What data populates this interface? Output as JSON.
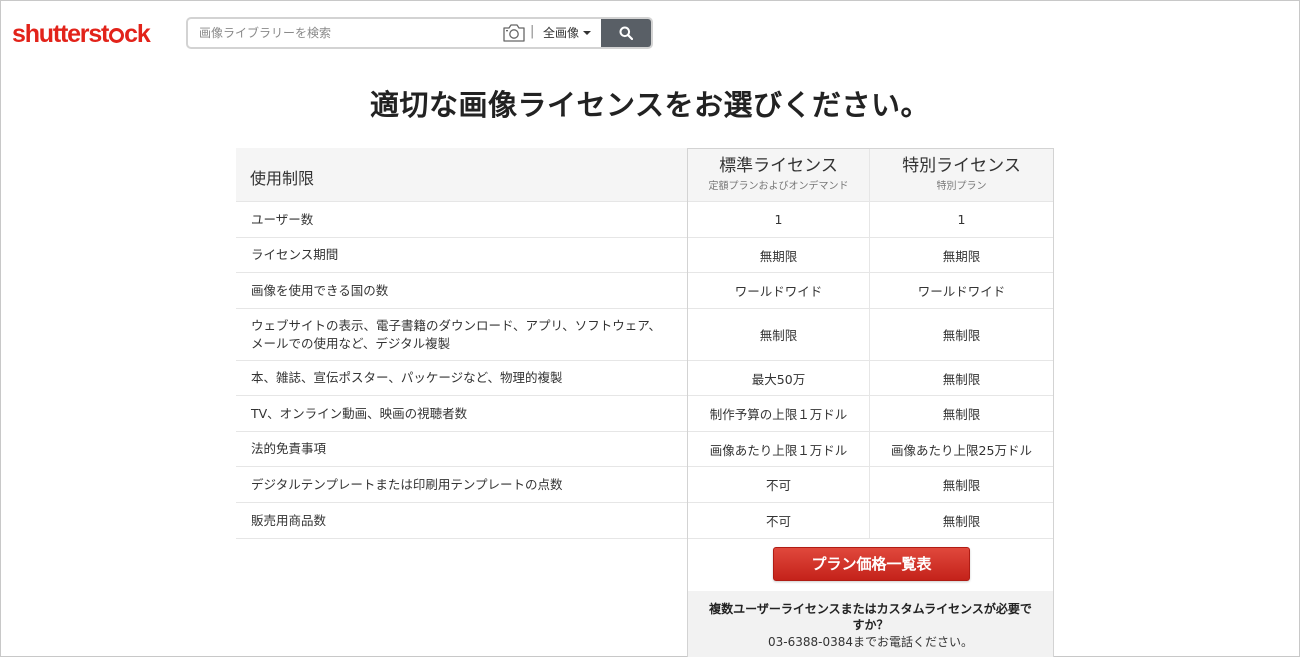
{
  "header": {
    "logo_before": "shutterst",
    "logo_after": "ck",
    "search_placeholder": "画像ライブラリーを検索",
    "separator": "|",
    "type_select_label": "全画像",
    "icons": {
      "camera": "camera-icon",
      "caret": "caret-down-icon",
      "search": "search-icon"
    }
  },
  "main": {
    "title": "適切な画像ライセンスをお選びください。",
    "table": {
      "header_label": "使用制限",
      "plans": [
        {
          "name": "標準ライセンス",
          "sub": "定額プランおよびオンデマンド"
        },
        {
          "name": "特別ライセンス",
          "sub": "特別プラン"
        }
      ],
      "rows": [
        {
          "label": "ユーザー数",
          "standard": "1",
          "enhanced": "1"
        },
        {
          "label": "ライセンス期間",
          "standard": "無期限",
          "enhanced": "無期限"
        },
        {
          "label": "画像を使用できる国の数",
          "standard": "ワールドワイド",
          "enhanced": "ワールドワイド"
        },
        {
          "label": "ウェブサイトの表示、電子書籍のダウンロード、アプリ、ソフトウェア、メールでの使用など、デジタル複製",
          "standard": "無制限",
          "enhanced": "無制限"
        },
        {
          "label": "本、雑誌、宣伝ポスター、パッケージなど、物理的複製",
          "standard": "最大50万",
          "enhanced": "無制限"
        },
        {
          "label": "TV、オンライン動画、映画の視聴者数",
          "standard": "制作予算の上限１万ドル",
          "enhanced": "無制限"
        },
        {
          "label": "法的免責事項",
          "standard": "画像あたり上限１万ドル",
          "enhanced": "画像あたり上限25万ドル"
        },
        {
          "label": "デジタルテンプレートまたは印刷用テンプレートの点数",
          "standard": "不可",
          "enhanced": "無制限"
        },
        {
          "label": "販売用商品数",
          "standard": "不可",
          "enhanced": "無制限"
        }
      ]
    },
    "cta_label": "プラン価格一覧表",
    "contact_question": "複数ユーザーライセンスまたはカスタムライセンスが必要ですか？",
    "contact_phone": "03-6388-0384までお電話ください。"
  },
  "colors": {
    "brand_red": "#e2231a",
    "search_button": "#595f66",
    "header_bg": "#f5f5f5"
  }
}
